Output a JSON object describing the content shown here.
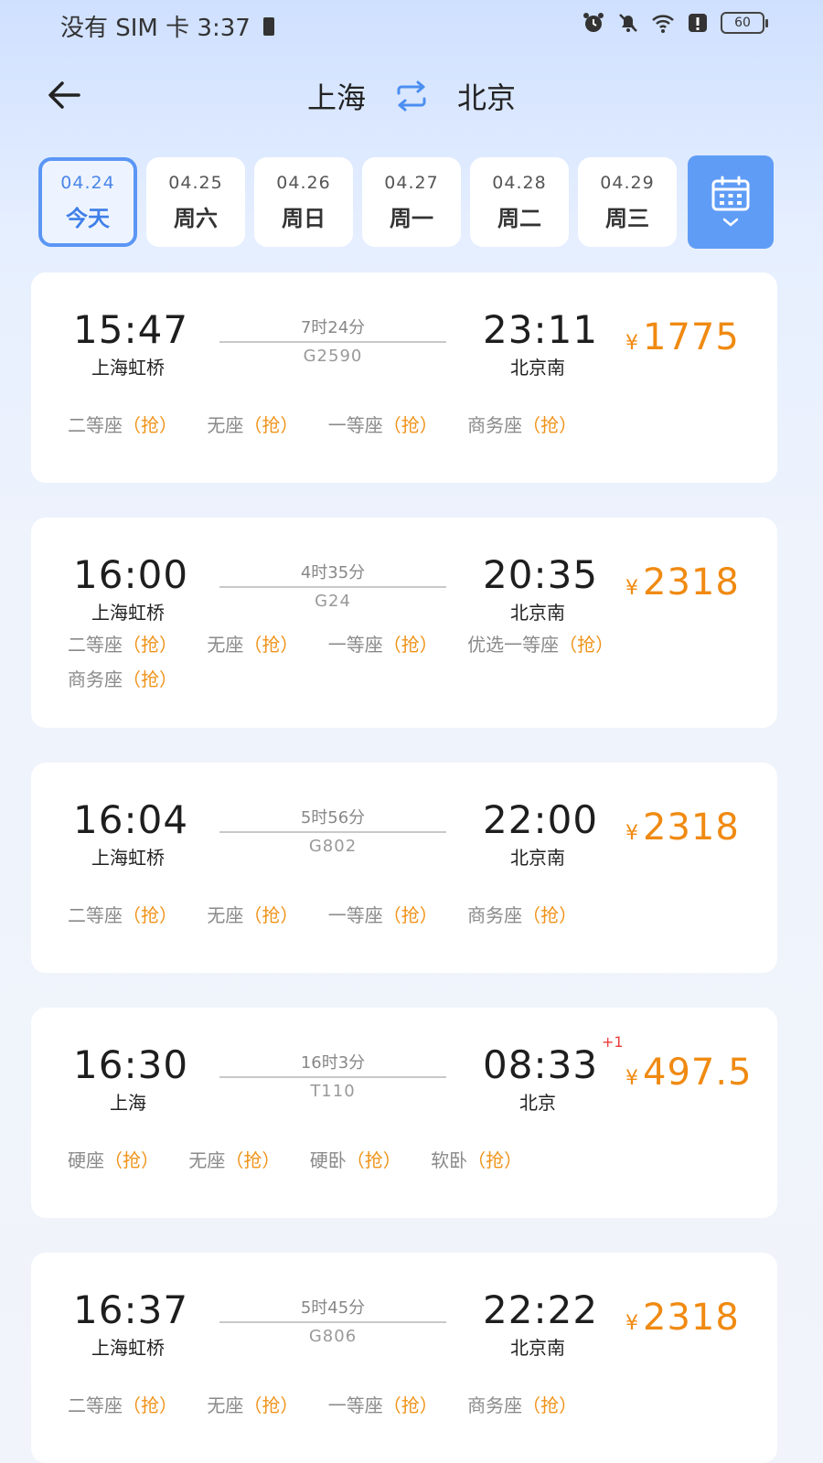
{
  "status": {
    "left": "没有 SIM 卡 3:37",
    "battery": "60"
  },
  "header": {
    "from": "上海",
    "to": "北京"
  },
  "dates": [
    {
      "date": "04.24",
      "label": "今天",
      "active": true
    },
    {
      "date": "04.25",
      "label": "周六"
    },
    {
      "date": "04.26",
      "label": "周日"
    },
    {
      "date": "04.27",
      "label": "周一"
    },
    {
      "date": "04.28",
      "label": "周二"
    },
    {
      "date": "04.29",
      "label": "周三"
    }
  ],
  "trains": [
    {
      "dep": "15:47",
      "dep_station": "上海虹桥",
      "duration": "7时24分",
      "no": "G2590",
      "arr": "23:11",
      "arr_station": "北京南",
      "price": "1775",
      "seats": [
        [
          "二等座",
          "（抢）"
        ],
        [
          "无座",
          "（抢）"
        ],
        [
          "一等座",
          "（抢）"
        ],
        [
          "商务座",
          "（抢）"
        ]
      ]
    },
    {
      "dep": "16:00",
      "dep_station": "上海虹桥",
      "duration": "4时35分",
      "no": "G24",
      "arr": "20:35",
      "arr_station": "北京南",
      "price": "2318",
      "seats": [
        [
          "二等座",
          "（抢）"
        ],
        [
          "无座",
          "（抢）"
        ],
        [
          "一等座",
          "（抢）"
        ],
        [
          "优选一等座",
          "（抢）"
        ],
        [
          "商务座",
          "（抢）"
        ]
      ]
    },
    {
      "dep": "16:04",
      "dep_station": "上海虹桥",
      "duration": "5时56分",
      "no": "G802",
      "arr": "22:00",
      "arr_station": "北京南",
      "price": "2318",
      "seats": [
        [
          "二等座",
          "（抢）"
        ],
        [
          "无座",
          "（抢）"
        ],
        [
          "一等座",
          "（抢）"
        ],
        [
          "商务座",
          "（抢）"
        ]
      ]
    },
    {
      "dep": "16:30",
      "dep_station": "上海",
      "duration": "16时3分",
      "no": "T110",
      "arr": "08:33",
      "arr_station": "北京",
      "price": "497.5",
      "plus_day": "+1",
      "seats": [
        [
          "硬座",
          "（抢）"
        ],
        [
          "无座",
          "（抢）"
        ],
        [
          "硬卧",
          "（抢）"
        ],
        [
          "软卧",
          "（抢）"
        ]
      ]
    },
    {
      "dep": "16:37",
      "dep_station": "上海虹桥",
      "duration": "5时45分",
      "no": "G806",
      "arr": "22:22",
      "arr_station": "北京南",
      "price": "2318",
      "seats": [
        [
          "二等座",
          "（抢）"
        ],
        [
          "无座",
          "（抢）"
        ],
        [
          "一等座",
          "（抢）"
        ],
        [
          "商务座",
          "（抢）"
        ]
      ]
    }
  ],
  "currency": "¥",
  "colors": {
    "accent": "#5f9cf6",
    "price": "#f08a12",
    "grab": "#f0931a"
  }
}
